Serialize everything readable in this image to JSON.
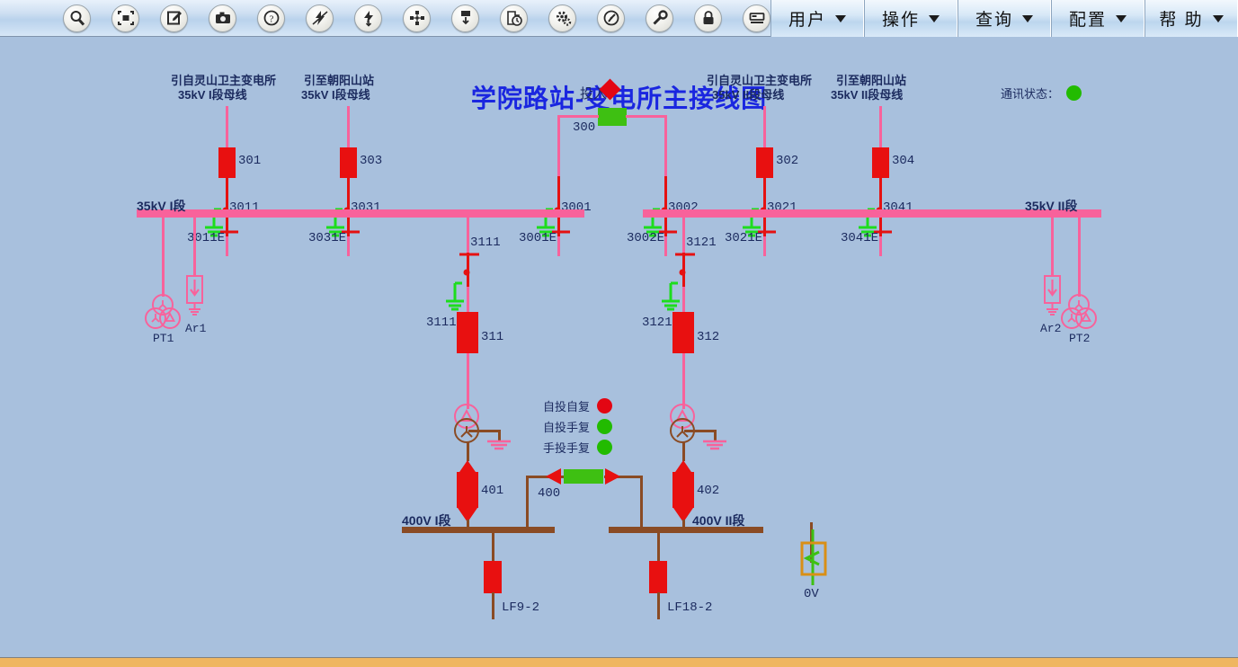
{
  "window": {
    "background_color": "#a8c0dd",
    "bottom_strip_color": "#efb661"
  },
  "toolbar": {
    "icons": [
      {
        "name": "search-icon",
        "tip": "搜索"
      },
      {
        "name": "fit-screen-icon",
        "tip": "全屏"
      },
      {
        "name": "edit-icon",
        "tip": "编辑"
      },
      {
        "name": "camera-icon",
        "tip": "截图"
      },
      {
        "name": "help-circle-icon",
        "tip": "帮助"
      },
      {
        "name": "fault-wave-icon",
        "tip": "波形"
      },
      {
        "name": "lightning-down-icon",
        "tip": "事故"
      },
      {
        "name": "network-node-icon",
        "tip": "网络"
      },
      {
        "name": "print-network-icon",
        "tip": "打印"
      },
      {
        "name": "history-clock-icon",
        "tip": "历史"
      },
      {
        "name": "gear-settings-icon",
        "tip": "设置"
      },
      {
        "name": "gauge-meter-icon",
        "tip": "仪表"
      },
      {
        "name": "wrench-key-icon",
        "tip": "维护"
      },
      {
        "name": "lock-icon",
        "tip": "锁定"
      },
      {
        "name": "device-terminal-icon",
        "tip": "终端"
      }
    ]
  },
  "menubar": {
    "items": [
      {
        "label": "用户"
      },
      {
        "label": "操作"
      },
      {
        "label": "查询"
      },
      {
        "label": "配置"
      },
      {
        "label": "帮 助"
      }
    ]
  },
  "header": {
    "title": "学院路站-变电所主接线图",
    "title_color": "#1a26e0",
    "comm_status_label": "通讯状态：",
    "comm_status_color": "#22bb00"
  },
  "diagram": {
    "incomers": [
      {
        "id": "301",
        "line1": "引自灵山卫主变电所",
        "line2": "35kV  I段母线"
      },
      {
        "id": "303",
        "line1": "引至朝阳山站",
        "line2": "35kV  I段母线"
      },
      {
        "id": "302",
        "line1": "引自灵山卫主变电所",
        "line2": "35kV  II段母线"
      },
      {
        "id": "304",
        "line1": "引至朝阳山站",
        "line2": "35kV  II段母线"
      }
    ],
    "bus_tie_35": {
      "id": "300",
      "state_label": "投入",
      "state_color": "#e30613",
      "device_color": "#3ec012"
    },
    "disconnectors": [
      {
        "id": "3011",
        "earth": "3011E"
      },
      {
        "id": "3031",
        "earth": "3031E"
      },
      {
        "id": "3001",
        "earth": "3001E"
      },
      {
        "id": "3002",
        "earth": "3002E"
      },
      {
        "id": "3021",
        "earth": "3021E"
      },
      {
        "id": "3041",
        "earth": "3041E"
      },
      {
        "id": "3111",
        "earth": "3111E"
      },
      {
        "id": "3121",
        "earth": "3121E"
      }
    ],
    "buses": [
      {
        "id": "bus-35kv-1",
        "label": "35kV  I段"
      },
      {
        "id": "bus-35kv-2",
        "label": "35kV  II段"
      },
      {
        "id": "bus-400v-1",
        "label": "400V  I段"
      },
      {
        "id": "bus-400v-2",
        "label": "400V  II段"
      }
    ],
    "pts": [
      {
        "id": "PT1"
      },
      {
        "id": "PT2"
      }
    ],
    "arresters": [
      {
        "id": "Ar1"
      },
      {
        "id": "Ar2"
      }
    ],
    "transformer_breakers": [
      {
        "id": "311"
      },
      {
        "id": "312"
      }
    ],
    "lv_breakers": [
      {
        "id": "401"
      },
      {
        "id": "402"
      }
    ],
    "bus_tie_400": {
      "id": "400",
      "device_color": "#3ec012"
    },
    "feeders": [
      {
        "id": "LF9-2"
      },
      {
        "id": "LF18-2"
      }
    ],
    "grounding": {
      "id": "0V",
      "box_color": "#d98f16",
      "wire_color": "#3ec012"
    },
    "auto_switch_states": [
      {
        "label": "自投自复",
        "color": "#e30613"
      },
      {
        "label": "自投手复",
        "color": "#22bb00"
      },
      {
        "label": "手投手复",
        "color": "#22bb00"
      }
    ]
  }
}
